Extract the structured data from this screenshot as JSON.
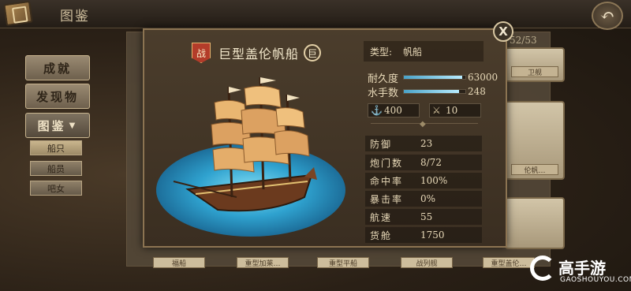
{
  "header": {
    "title": "图鉴",
    "back_icon": "back-arrow-icon",
    "book_icon": "book-icon"
  },
  "sidebar": {
    "items": [
      {
        "label": "成就"
      },
      {
        "label": "发现物"
      },
      {
        "label": "图鉴",
        "active": true
      }
    ],
    "sub_items": [
      {
        "label": "船只",
        "active": true
      },
      {
        "label": "船员"
      },
      {
        "label": "吧女"
      }
    ]
  },
  "collection": {
    "count": "52/53",
    "card_labels": [
      "卫舰",
      "伦帆…",
      ""
    ],
    "bottom_labels": [
      "福船",
      "重型加莱…",
      "重型平船",
      "战列舰",
      "重型盖伦…"
    ]
  },
  "modal": {
    "close_label": "X",
    "ship_badge": "战",
    "ship_name": "巨型盖伦帆船",
    "size_badge": "巨",
    "type_label": "类型:",
    "type_value": "帆船",
    "durability_label": "耐久度",
    "durability_value": "63000",
    "durability_fill": 0.95,
    "sailors_label": "水手数",
    "sailors_value": "248",
    "sailors_fill": 0.9,
    "cargo_res": "400",
    "cannon_res": "10",
    "stats": [
      {
        "k": "防御",
        "v": "23"
      },
      {
        "k": "炮门数",
        "v": "8/72"
      },
      {
        "k": "命中率",
        "v": "100%"
      },
      {
        "k": "暴击率",
        "v": "0%"
      },
      {
        "k": "航速",
        "v": "55"
      },
      {
        "k": "货舱",
        "v": "1750"
      }
    ]
  },
  "watermark": {
    "name": "高手游",
    "url": "GAOSHOUYOU.COM"
  },
  "colors": {
    "accent": "#b33c2a",
    "ocean": "#2fa2cf",
    "bar": "#8fd3ee"
  }
}
